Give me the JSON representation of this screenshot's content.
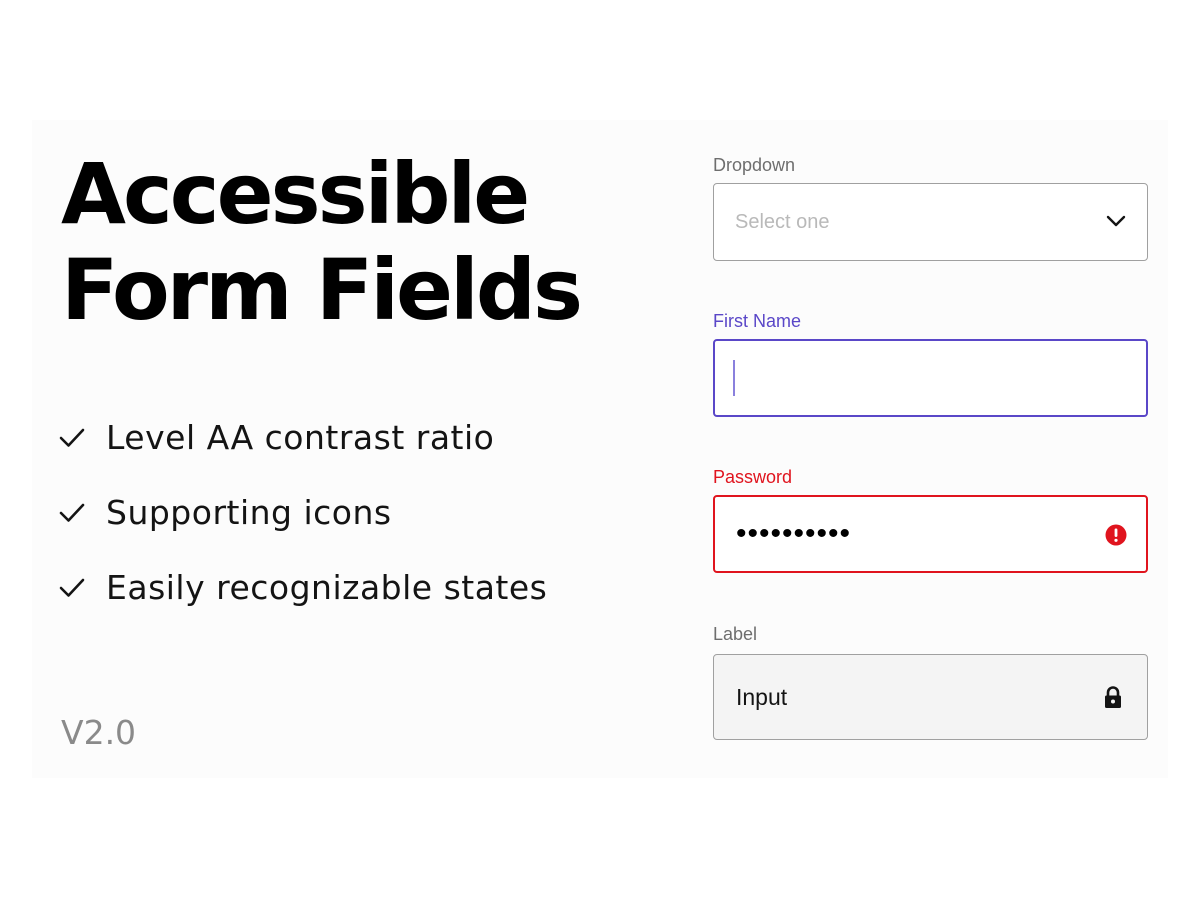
{
  "hero": {
    "title_line1": "Accessible",
    "title_line2": "Form Fields",
    "version": "V2.0"
  },
  "features": [
    {
      "icon": "check-icon",
      "text": "Level AA contrast ratio"
    },
    {
      "icon": "check-icon",
      "text": "Supporting icons"
    },
    {
      "icon": "check-icon",
      "text": "Easily recognizable states"
    }
  ],
  "fields": {
    "dropdown": {
      "label": "Dropdown",
      "placeholder": "Select one",
      "icon": "chevron-down-icon",
      "state": "default"
    },
    "first_name": {
      "label": "First Name",
      "value": "",
      "state": "focused"
    },
    "password": {
      "label": "Password",
      "value_masked": "••••••••••",
      "icon": "error-icon",
      "state": "error"
    },
    "disabled": {
      "label": "Label",
      "value": "Input",
      "icon": "lock-icon",
      "state": "disabled"
    }
  },
  "colors": {
    "focus": "#5a47c8",
    "error": "#e0141e",
    "border_default": "#a0a0a0",
    "disabled_bg": "#f4f4f4"
  }
}
